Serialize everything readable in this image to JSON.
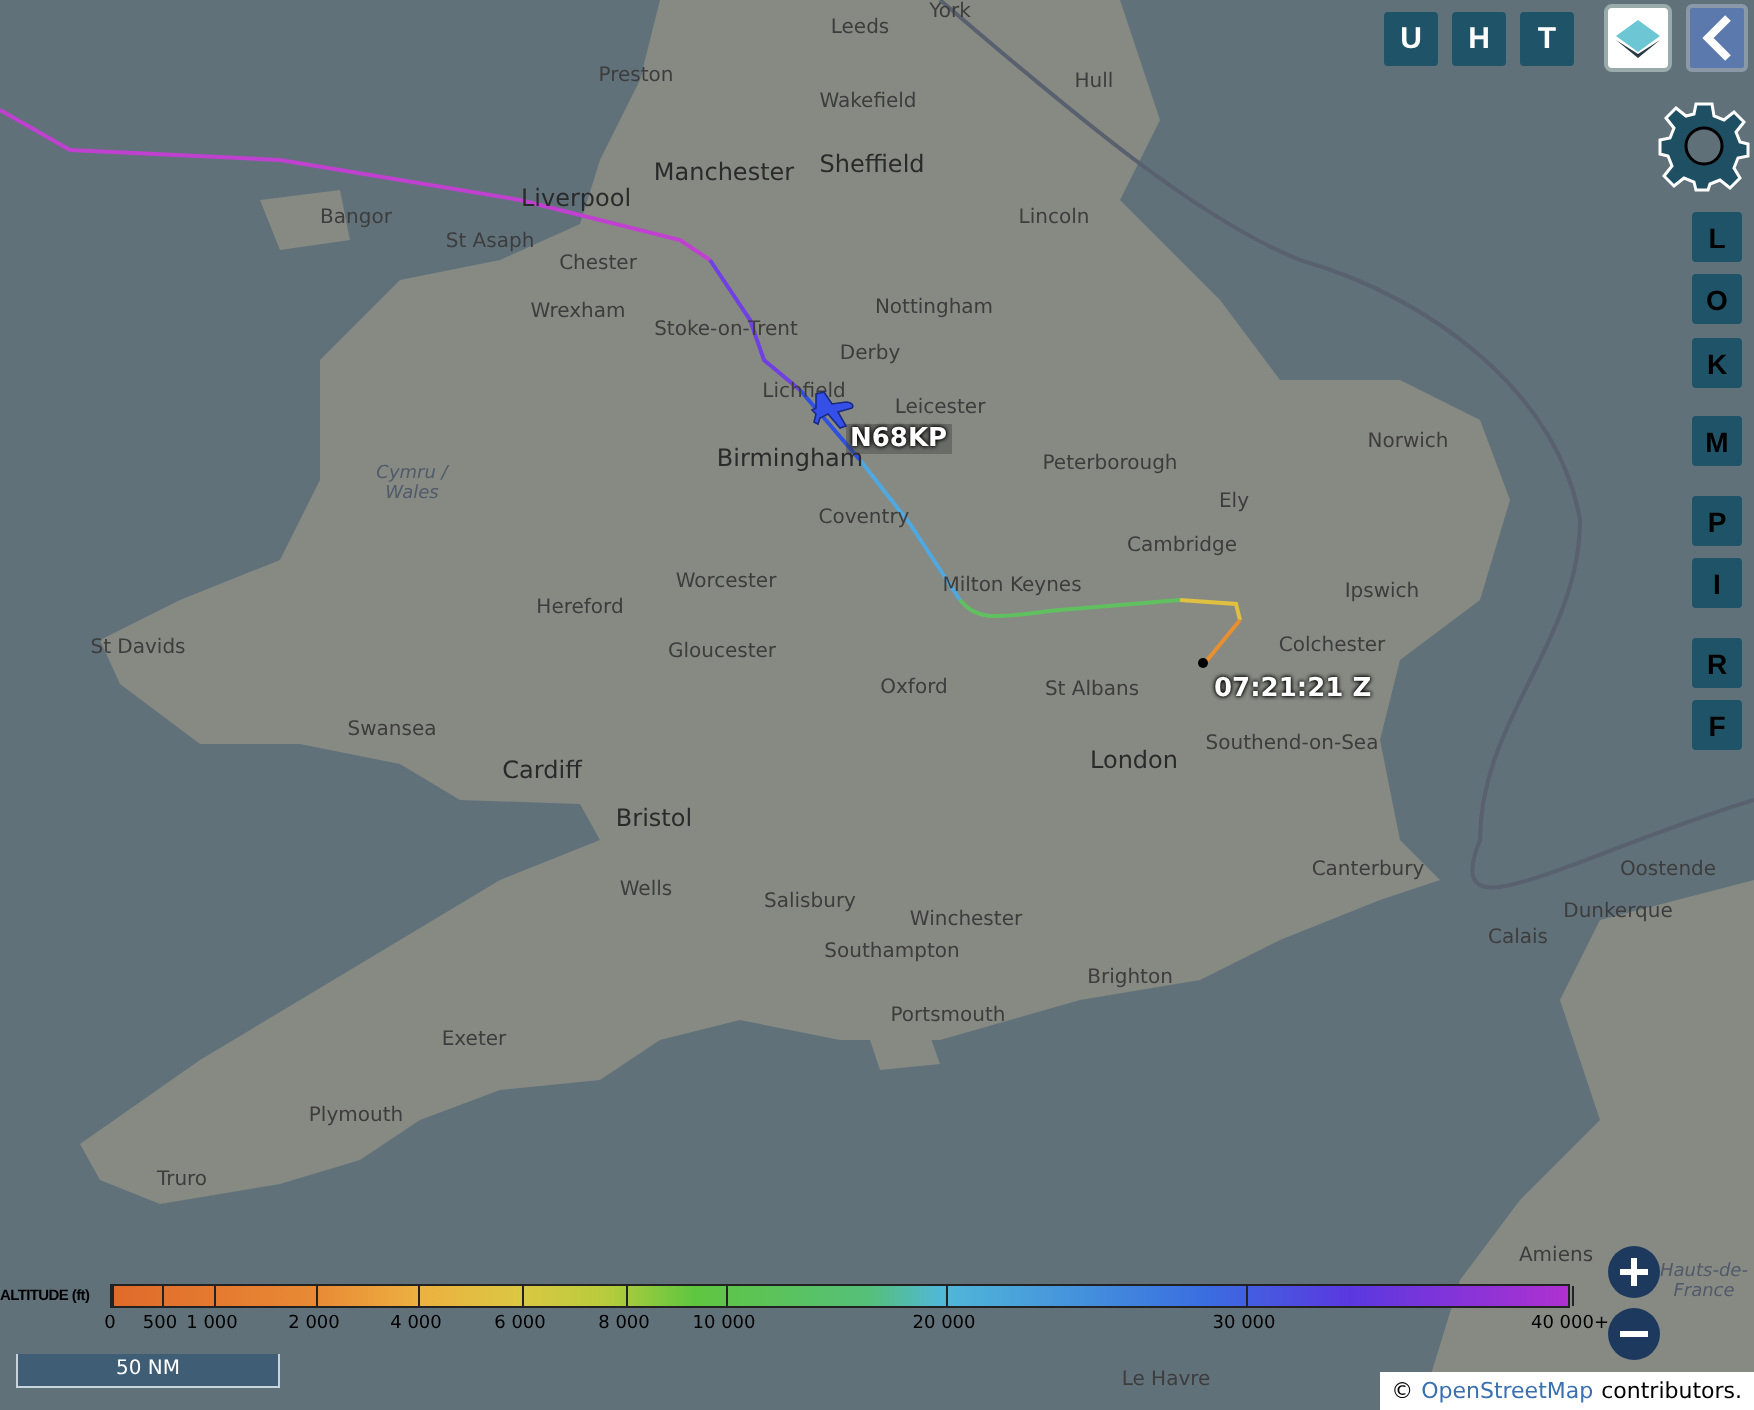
{
  "top_buttons": [
    {
      "label": "U"
    },
    {
      "label": "H"
    },
    {
      "label": "T"
    }
  ],
  "side_buttons": [
    {
      "label": "L"
    },
    {
      "label": "O"
    },
    {
      "label": "K"
    },
    {
      "label": "M"
    },
    {
      "label": "P"
    },
    {
      "label": "I"
    },
    {
      "label": "R"
    },
    {
      "label": "F"
    }
  ],
  "map_labels": [
    {
      "text": "Leeds",
      "kind": "city"
    },
    {
      "text": "York",
      "kind": "city"
    },
    {
      "text": "Preston",
      "kind": "city"
    },
    {
      "text": "Wakefield",
      "kind": "city"
    },
    {
      "text": "Hull",
      "kind": "city"
    },
    {
      "text": "Manchester",
      "kind": "major"
    },
    {
      "text": "Sheffield",
      "kind": "major"
    },
    {
      "text": "Bangor",
      "kind": "city"
    },
    {
      "text": "Liverpool",
      "kind": "major"
    },
    {
      "text": "Lincoln",
      "kind": "city"
    },
    {
      "text": "St Asaph",
      "kind": "city"
    },
    {
      "text": "Chester",
      "kind": "city"
    },
    {
      "text": "Wrexham",
      "kind": "city"
    },
    {
      "text": "Stoke-on-Trent",
      "kind": "city"
    },
    {
      "text": "Nottingham",
      "kind": "city"
    },
    {
      "text": "Derby",
      "kind": "city"
    },
    {
      "text": "Lichfield",
      "kind": "city"
    },
    {
      "text": "Leicester",
      "kind": "city"
    },
    {
      "text": "Norwich",
      "kind": "city"
    },
    {
      "text": "Birmingham",
      "kind": "major"
    },
    {
      "text": "Peterborough",
      "kind": "city"
    },
    {
      "text": "Ely",
      "kind": "city"
    },
    {
      "text": "Cymru / Wales",
      "kind": "region"
    },
    {
      "text": "Coventry",
      "kind": "city"
    },
    {
      "text": "Cambridge",
      "kind": "city"
    },
    {
      "text": "Ipswich",
      "kind": "city"
    },
    {
      "text": "Worcester",
      "kind": "city"
    },
    {
      "text": "Hereford",
      "kind": "city"
    },
    {
      "text": "Milton Keynes",
      "kind": "city"
    },
    {
      "text": "St Davids",
      "kind": "city"
    },
    {
      "text": "Gloucester",
      "kind": "city"
    },
    {
      "text": "Colchester",
      "kind": "city"
    },
    {
      "text": "Oxford",
      "kind": "city"
    },
    {
      "text": "St Albans",
      "kind": "city"
    },
    {
      "text": "Swansea",
      "kind": "city"
    },
    {
      "text": "Southend-on-Sea",
      "kind": "city"
    },
    {
      "text": "Cardiff",
      "kind": "major"
    },
    {
      "text": "London",
      "kind": "major"
    },
    {
      "text": "Bristol",
      "kind": "major"
    },
    {
      "text": "Canterbury",
      "kind": "city"
    },
    {
      "text": "Oostende",
      "kind": "city"
    },
    {
      "text": "Wells",
      "kind": "city"
    },
    {
      "text": "Salisbury",
      "kind": "city"
    },
    {
      "text": "Dunkerque",
      "kind": "city"
    },
    {
      "text": "Winchester",
      "kind": "city"
    },
    {
      "text": "Calais",
      "kind": "city"
    },
    {
      "text": "Southampton",
      "kind": "city"
    },
    {
      "text": "Brighton",
      "kind": "city"
    },
    {
      "text": "Portsmouth",
      "kind": "city"
    },
    {
      "text": "Exeter",
      "kind": "city"
    },
    {
      "text": "Plymouth",
      "kind": "city"
    },
    {
      "text": "Truro",
      "kind": "city"
    },
    {
      "text": "Amiens",
      "kind": "city"
    },
    {
      "text": "Hauts-de-France",
      "kind": "region"
    },
    {
      "text": "Le Havre",
      "kind": "city"
    }
  ],
  "aircraft": {
    "callsign": "N68KP"
  },
  "track_end": {
    "time": "07:21:21 Z"
  },
  "legend": {
    "title": "ALTITUDE (ft)",
    "ticks": [
      "0",
      "500",
      "1 000",
      "2 000",
      "4 000",
      "6 000",
      "8 000",
      "10 000",
      "20 000",
      "30 000",
      "40 000+"
    ]
  },
  "scale": {
    "label": "50 NM"
  },
  "attribution": {
    "symbol": "©",
    "link": "OpenStreetMap",
    "text": "contributors."
  }
}
